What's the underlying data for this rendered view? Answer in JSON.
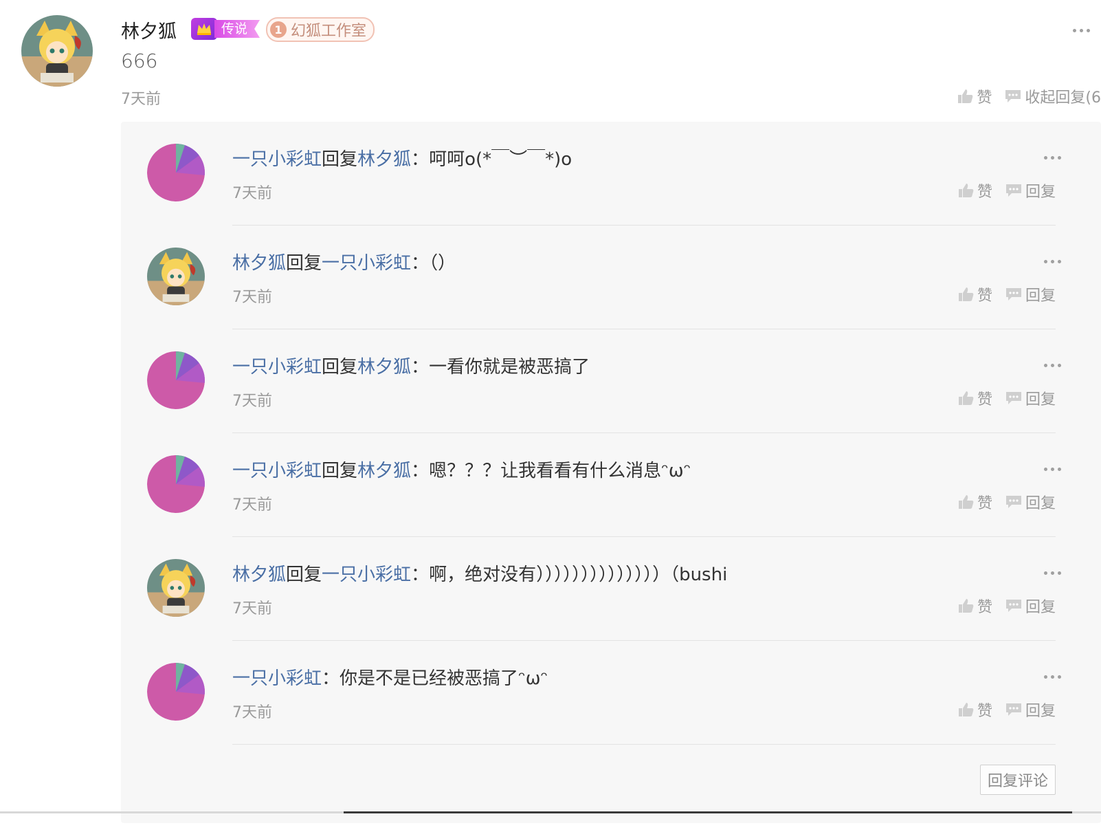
{
  "main_comment": {
    "author": "林夕狐",
    "badge_legend": "传说",
    "badge_studio_level": "1",
    "badge_studio": "幻狐工作室",
    "text": "666",
    "time": "7天前",
    "like_label": "赞",
    "collapse_label": "收起回复(6"
  },
  "replies": [
    {
      "user": "一只小彩虹",
      "connector": "回复",
      "target": "林夕狐",
      "colon": "：",
      "text": "呵呵o(*￣︶￣*)o",
      "time": "7天前",
      "like": "赞",
      "reply": "回复",
      "avatar": "rainbow"
    },
    {
      "user": "林夕狐",
      "connector": "回复",
      "target": "一只小彩虹",
      "colon": "：",
      "text": "（）",
      "time": "7天前",
      "like": "赞",
      "reply": "回复",
      "avatar": "fox"
    },
    {
      "user": "一只小彩虹",
      "connector": "回复",
      "target": "林夕狐",
      "colon": "：",
      "text": "一看你就是被恶搞了",
      "time": "7天前",
      "like": "赞",
      "reply": "回复",
      "avatar": "rainbow"
    },
    {
      "user": "一只小彩虹",
      "connector": "回复",
      "target": "林夕狐",
      "colon": "：",
      "text": "嗯？？？让我看看有什么消息ᵔωᵔ",
      "time": "7天前",
      "like": "赞",
      "reply": "回复",
      "avatar": "rainbow"
    },
    {
      "user": "林夕狐",
      "connector": "回复",
      "target": "一只小彩虹",
      "colon": "：",
      "text": "啊，绝对没有））））））））））））））（bushi",
      "time": "7天前",
      "like": "赞",
      "reply": "回复",
      "avatar": "fox"
    },
    {
      "user": "一只小彩虹",
      "connector": "",
      "target": "",
      "colon": "：",
      "text": "你是不是已经被恶搞了ᵔωᵔ",
      "time": "7天前",
      "like": "赞",
      "reply": "回复",
      "avatar": "rainbow"
    }
  ],
  "reply_comment_button": "回复评论",
  "colors": {
    "username": "#4a6fa5",
    "muted": "#9a9a9a",
    "panel_bg": "#f7f7f7"
  }
}
